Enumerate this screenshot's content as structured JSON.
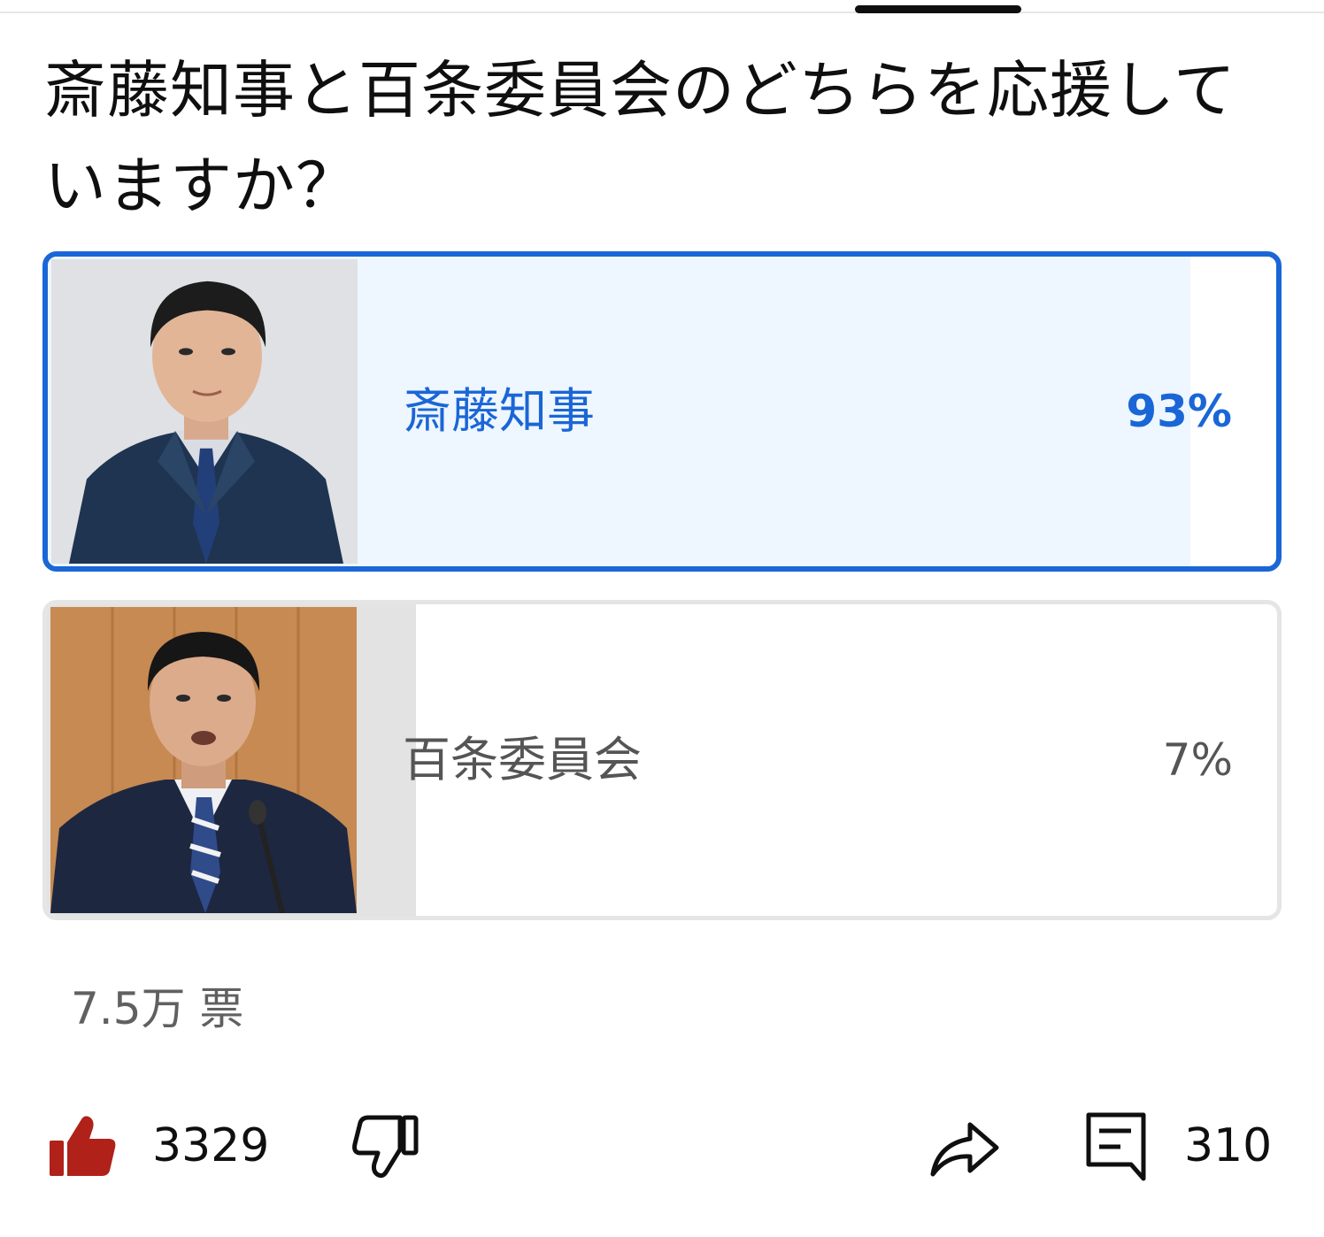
{
  "poll": {
    "question": "斎藤知事と百条委員会のどちらを応援していますか？",
    "options": [
      {
        "label": "斎藤知事",
        "percent_text": "93%",
        "percent": 93,
        "selected": true,
        "thumbnail": "portrait-man-in-suit-gray-background"
      },
      {
        "label": "百条委員会",
        "percent_text": "7%",
        "percent": 7,
        "selected": false,
        "thumbnail": "man-speaking-at-microphone-wood-background"
      }
    ],
    "votes_label": "7.5万 票"
  },
  "actions": {
    "like_count": "3329",
    "comment_count": "310",
    "like_icon": "thumbs-up-icon",
    "dislike_icon": "thumbs-down-icon",
    "share_icon": "share-icon",
    "comment_icon": "comment-icon"
  },
  "colors": {
    "accent": "#1a66d6",
    "selected_fill": "#eef6ff",
    "unselected_fill": "#e3e3e3",
    "like_active": "#b0211a",
    "text_primary": "#0f0f0f",
    "text_secondary": "#606060"
  }
}
